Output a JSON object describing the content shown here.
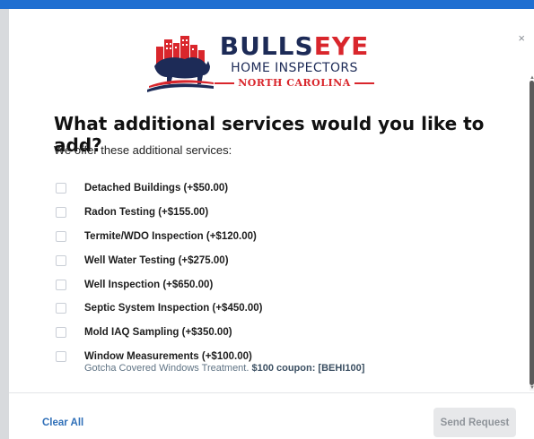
{
  "colors": {
    "accent": "#1f6fd1",
    "brand_navy": "#1d2b57",
    "brand_red": "#d9262c",
    "link": "#2f6fb8"
  },
  "modal": {
    "close_label": "×",
    "logo": {
      "word_part1": "BULLS",
      "word_part2": "EYE",
      "line2": "HOME INSPECTORS",
      "line3": "NORTH CAROLINA"
    },
    "title": "What additional services would you like to add?",
    "subtitle": "We offer these additional services:",
    "services": [
      {
        "label": "Detached Buildings (+$50.00)",
        "checked": false
      },
      {
        "label": "Radon Testing (+$155.00)",
        "checked": false
      },
      {
        "label": "Termite/WDO Inspection (+$120.00)",
        "checked": false
      },
      {
        "label": "Well Water Testing (+$275.00)",
        "checked": false
      },
      {
        "label": "Well Inspection (+$650.00)",
        "checked": false
      },
      {
        "label": "Septic System Inspection (+$450.00)",
        "checked": false
      },
      {
        "label": "Mold IAQ Sampling (+$350.00)",
        "checked": false
      },
      {
        "label": "Window Measurements (+$100.00)",
        "checked": false
      }
    ],
    "window_note": {
      "text": "Gotcha Covered Windows Treatment. ",
      "coupon": "$100 coupon: [BEHI100]"
    },
    "footer": {
      "clear_all": "Clear All",
      "send_request": "Send Request"
    }
  }
}
